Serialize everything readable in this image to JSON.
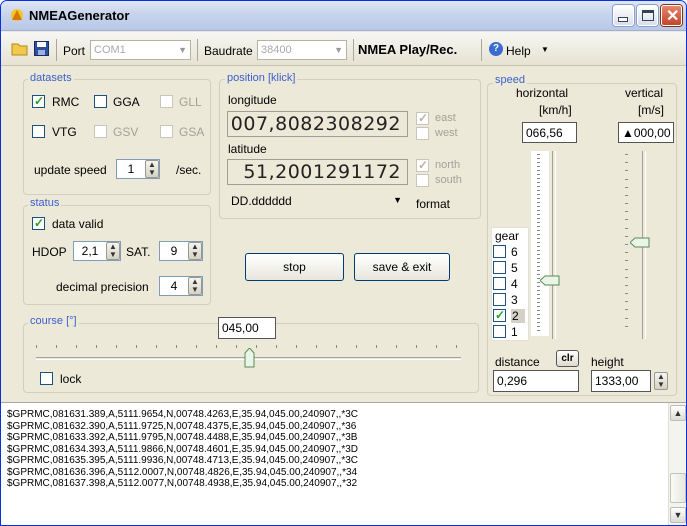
{
  "window": {
    "title": "NMEAGenerator"
  },
  "toolbar": {
    "port_label": "Port",
    "port_value": "COM1",
    "baudrate_label": "Baudrate",
    "baudrate_value": "38400",
    "mode_label": "NMEA Play/Rec.",
    "help_label": "Help"
  },
  "datasets": {
    "title": "datasets",
    "items": [
      {
        "label": "RMC",
        "checked": true,
        "enabled": true
      },
      {
        "label": "GGA",
        "checked": false,
        "enabled": true
      },
      {
        "label": "GLL",
        "checked": false,
        "enabled": false
      },
      {
        "label": "VTG",
        "checked": false,
        "enabled": true
      },
      {
        "label": "GSV",
        "checked": false,
        "enabled": false
      },
      {
        "label": "GSA",
        "checked": false,
        "enabled": false
      }
    ],
    "update_speed_label": "update speed",
    "update_speed_value": "1",
    "update_speed_unit": "/sec."
  },
  "status": {
    "title": "status",
    "data_valid_label": "data valid",
    "hdop_label": "HDOP",
    "hdop_value": "2,1",
    "sat_label": "SAT.",
    "sat_value": "9",
    "decimal_label": "decimal precision",
    "decimal_value": "4"
  },
  "position": {
    "title": "position [klick]",
    "longitude_label": "longitude",
    "longitude_value": "007,8082308292",
    "east_label": "east",
    "west_label": "west",
    "latitude_label": "latitude",
    "latitude_value": "51,2001291172",
    "north_label": "north",
    "south_label": "south",
    "format_value": "DD.dddddd",
    "format_label": "format"
  },
  "actions": {
    "stop_label": "stop",
    "save_label": "save & exit"
  },
  "course": {
    "title": "course [°]",
    "value": "045,00",
    "lock_label": "lock",
    "level": 0.4
  },
  "speed": {
    "title": "speed",
    "horizontal_label": "horizontal",
    "horizontal_unit": "[km/h]",
    "horizontal_value": "066,56",
    "vertical_label": "vertical",
    "vertical_unit": "[m/s]",
    "vertical_value": "▲000,00",
    "gear_label": "gear",
    "gears": [
      "6",
      "5",
      "4",
      "3",
      "2",
      "1"
    ],
    "selected_gear": "2",
    "distance_label": "distance",
    "clr_label": "clr",
    "distance_value": "0,296",
    "height_label": "height",
    "height_value": "1333,00"
  },
  "log_lines": [
    "$GPRMC,081631.389,A,5111.9654,N,00748.4263,E,35.94,045.00,240907,,*3C",
    "$GPRMC,081632.390,A,5111.9725,N,00748.4375,E,35.94,045.00,240907,,*36",
    "$GPRMC,081633.392,A,5111.9795,N,00748.4488,E,35.94,045.00,240907,,*3B",
    "$GPRMC,081634.393,A,5111.9866,N,00748.4601,E,35.94,045.00,240907,,*3D",
    "$GPRMC,081635.395,A,5111.9936,N,00748.4713,E,35.94,045.00,240907,,*3C",
    "$GPRMC,081636.396,A,5112.0007,N,00748.4826,E,35.94,045.00,240907,,*34",
    "$GPRMC,081637.398,A,5112.0077,N,00748.4938,E,35.94,045.00,240907,,*32"
  ]
}
